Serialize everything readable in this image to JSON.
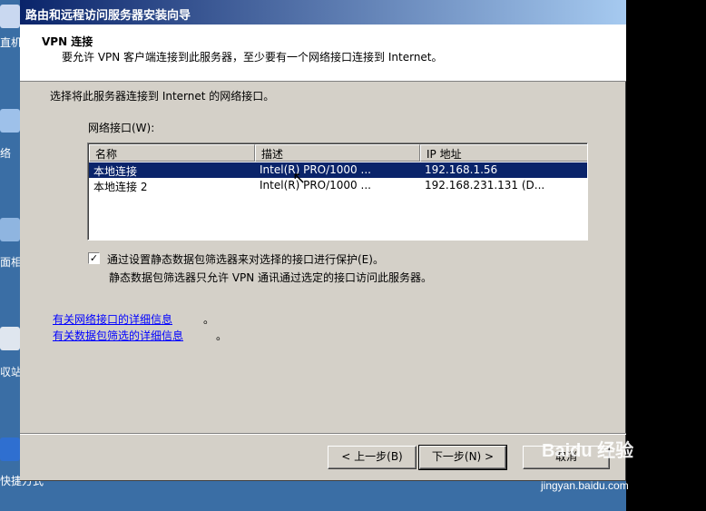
{
  "window": {
    "title": "路由和远程访问服务器安装向导"
  },
  "header": {
    "title": "VPN 连接",
    "subtitle": "要允许 VPN 客户端连接到此服务器，至少要有一个网络接口连接到 Internet。"
  },
  "body": {
    "instruction": "选择将此服务器连接到 Internet 的网络接口。",
    "list_label": "网络接口(W):",
    "columns": [
      "名称",
      "描述",
      "IP 地址"
    ],
    "rows": [
      {
        "name": "本地连接",
        "description": "Intel(R) PRO/1000 ...",
        "ip": "192.168.1.56",
        "selected": true
      },
      {
        "name": "本地连接 2",
        "description": "Intel(R) PRO/1000 ...",
        "ip": "192.168.231.131  (D...",
        "selected": false
      }
    ],
    "checkbox": {
      "checked": true,
      "mark": "✓",
      "label": "通过设置静态数据包筛选器来对选择的接口进行保护(E)。",
      "note": "静态数据包筛选器只允许 VPN 通讯通过选定的接口访问此服务器。"
    },
    "links": [
      {
        "text": "有关网络接口的详细信息",
        "tail": "。"
      },
      {
        "text": "有关数据包筛选的详细信息",
        "tail": "。"
      }
    ]
  },
  "footer": {
    "back_label": "< 上一步(B)",
    "next_label": "下一步(N) >",
    "cancel_label": "取消"
  },
  "desktop": {
    "labels": [
      "直机",
      "络",
      "面相",
      "収站",
      "快捷方式"
    ]
  },
  "watermark": {
    "brand": "Baidu 经验",
    "url": "jingyan.baidu.com"
  },
  "colors": {
    "titlebar": "#0a246a",
    "selection": "#0a246a",
    "dialog_bg": "#d4d0c8",
    "link": "#0000ff",
    "desktop": "#3a6ea5"
  }
}
